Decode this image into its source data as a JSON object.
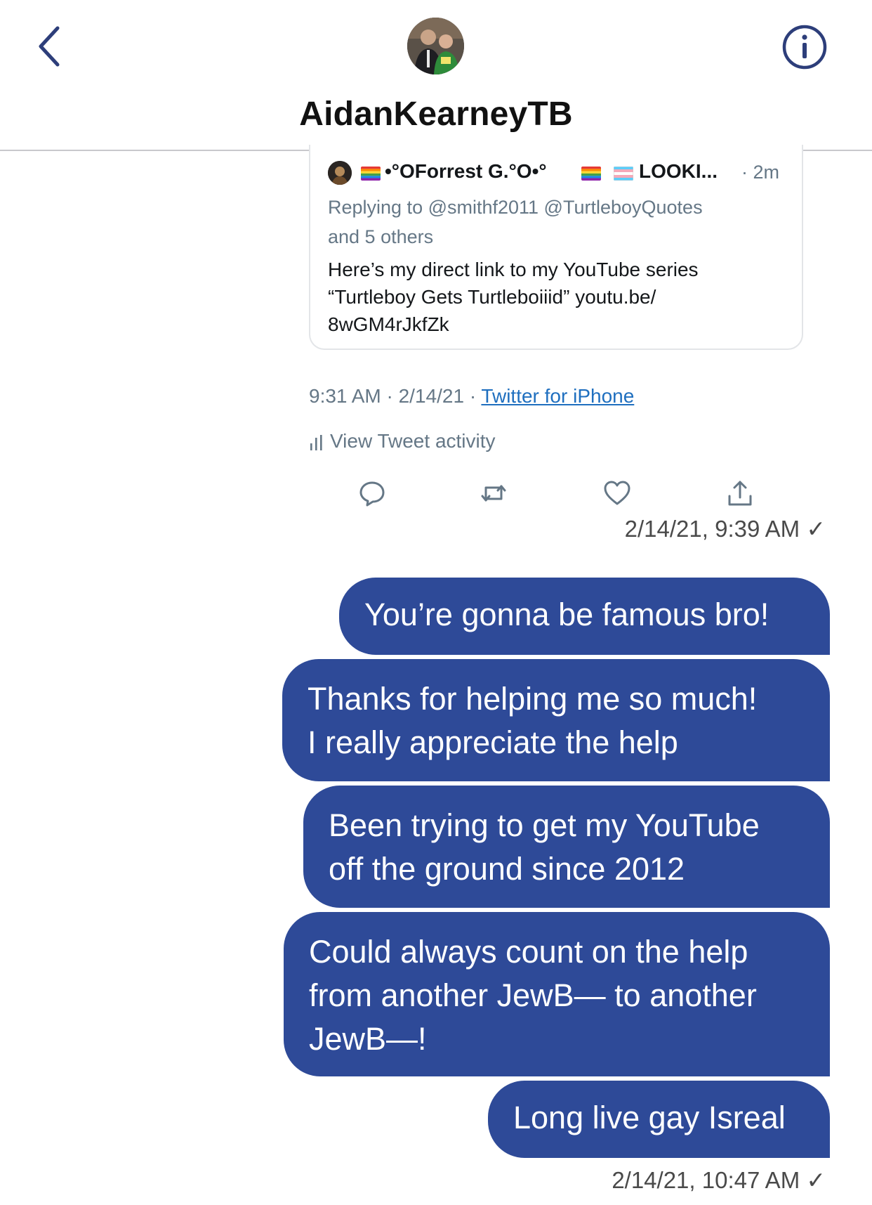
{
  "header": {
    "title": "AidanKearneyTB",
    "back_icon": "chevron-left-icon",
    "info_icon": "info-icon"
  },
  "tweet": {
    "author": "•°OForrest G.°O•°",
    "author_suffix": "LOOKI...",
    "time_ago": "· 2m",
    "replying_line1": "Replying to @smithf2011 @TurtleboyQuotes",
    "replying_line2": "and 5 others",
    "text_line1": "Here’s my direct link to my YouTube series",
    "text_line2": "“Turtleboy Gets Turtleboiiid” youtu.be/",
    "text_line3": "8wGM4rJkfZk",
    "timestamp": "9:31 AM · 2/14/21 ·",
    "source": "Twitter for iPhone",
    "activity": "View Tweet activity"
  },
  "messages": {
    "stamp1": "2/14/21, 9:39 AM ✓",
    "m1": "You’re gonna be famous bro!",
    "m2_l1": "Thanks for helping me so much!",
    "m2_l2": "I really appreciate the help",
    "m3_l1": "Been trying to get my YouTube",
    "m3_l2": "off the ground since 2012",
    "m4_l1": "Could always count on the help",
    "m4_l2": "from another JewB— to another",
    "m4_l3": "JewB—!",
    "m5": "Long live gay Isreal",
    "stamp2": "2/14/21, 10:47 AM ✓"
  },
  "colors": {
    "bubble": "#2e4a98",
    "header_icons": "#2d3e7a",
    "link": "#1f6fbf"
  }
}
